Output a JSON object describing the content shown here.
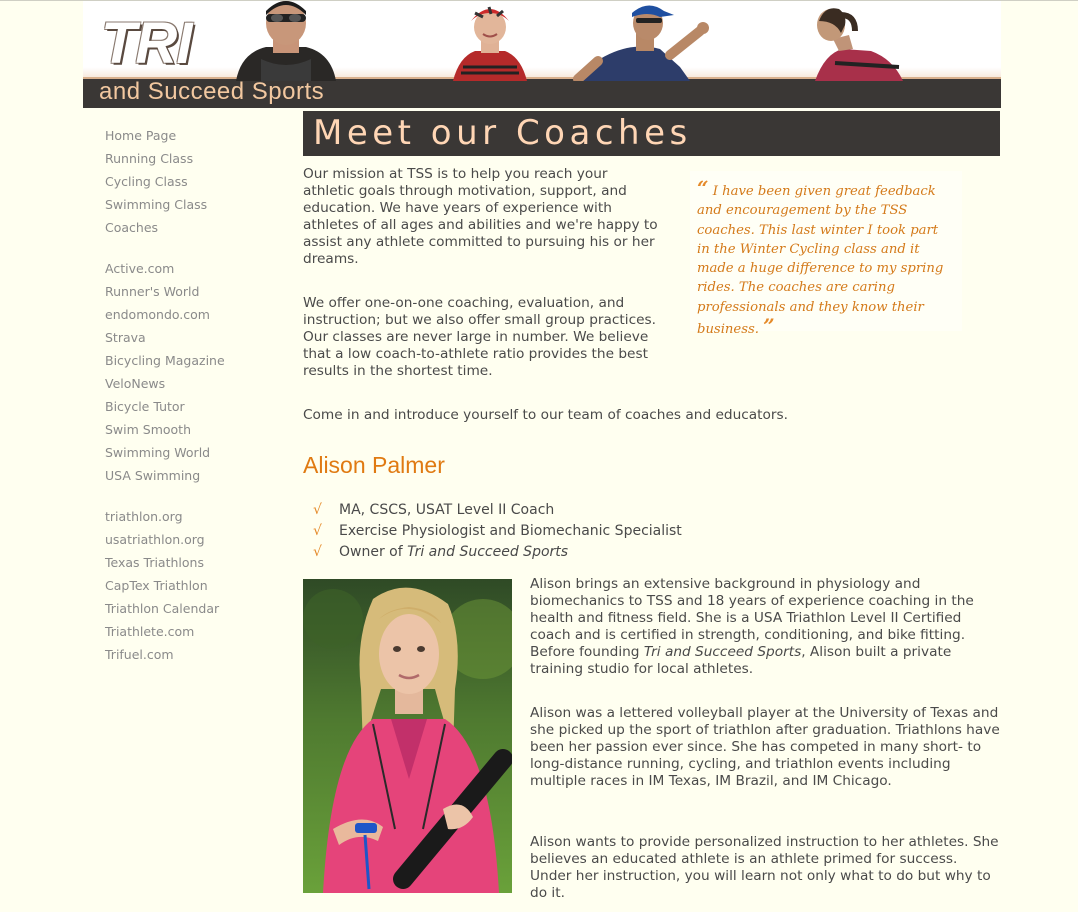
{
  "header": {
    "logo_main": "TRI",
    "logo_sub": "and Succeed Sports",
    "colors": {
      "bar": "#3a3735",
      "logo_sub": "#f2c8a0"
    }
  },
  "sidebar": {
    "groups": [
      [
        "Home Page",
        "Running Class",
        "Cycling Class",
        "Swimming Class",
        "Coaches"
      ],
      [
        "Active.com",
        "Runner's World",
        "endomondo.com",
        "Strava",
        "Bicycling Magazine",
        "VeloNews",
        "Bicycle Tutor",
        "Swim Smooth",
        "Swimming World",
        "USA Swimming"
      ],
      [
        "triathlon.org",
        "usatriathlon.org",
        "Texas Triathlons",
        "CapTex Triathlon",
        "Triathlon Calendar",
        "Triathlete.com",
        "Trifuel.com"
      ]
    ]
  },
  "main": {
    "title": "Meet our Coaches",
    "intro": [
      "Our mission at TSS is to help you reach your athletic goals through motivation, support, and education. We have years of experience with athletes of all ages and abilities and we're happy to assist any athlete committed to pursuing his or her dreams.",
      "We offer one-on-one coaching, evaluation, and instruction; but we also offer small group practices. Our classes are never large in number. We believe that a low coach-to-athlete ratio provides the best results in the shortest time.",
      "Come in and introduce yourself to our team of coaches and educators."
    ],
    "quote": {
      "open_mark": "“",
      "text": "I have been given great feedback and encouragement by the TSS coaches. This last winter I took part in the Winter Cycling class and it made a huge difference to my spring rides. The coaches are caring professionals and they know their business.",
      "close_mark": "”"
    },
    "coach": {
      "name": "Alison Palmer",
      "check_mark": "√",
      "credentials": [
        "MA, CSCS, USAT Level II Coach",
        "Exercise Physiologist and Biomechanic Specialist"
      ],
      "owner_prefix": "Owner of ",
      "owner_business": "Tri and Succeed Sports",
      "bio1_part1": "Alison brings an extensive background in physiology and biomechanics to TSS and 18 years of experience coaching in the health and fitness field. She is a USA Triathlon Level II Certified coach and is certified in strength, conditioning, and bike fitting. Before founding ",
      "bio1_em": "Tri and Succeed Sports",
      "bio1_part2": ", Alison built a private training studio for local athletes.",
      "bio2": "Alison was a lettered volleyball player at the University of Texas and she picked up the sport of triathlon after graduation. Triathlons have been her passion ever since. She has competed in many short- to long-distance running, cycling, and triathlon events including multiple races in IM Texas, IM Brazil, and IM Chicago.",
      "bio3": "Alison wants to provide personalized instruction to her athletes. She believes an educated athlete is an athlete primed for success. Under her instruction, you will learn not only what to do but why to do it."
    },
    "colors": {
      "accent": "#e07a12",
      "quote_text": "#d47a1a",
      "title_text": "#ffd6b5"
    }
  }
}
